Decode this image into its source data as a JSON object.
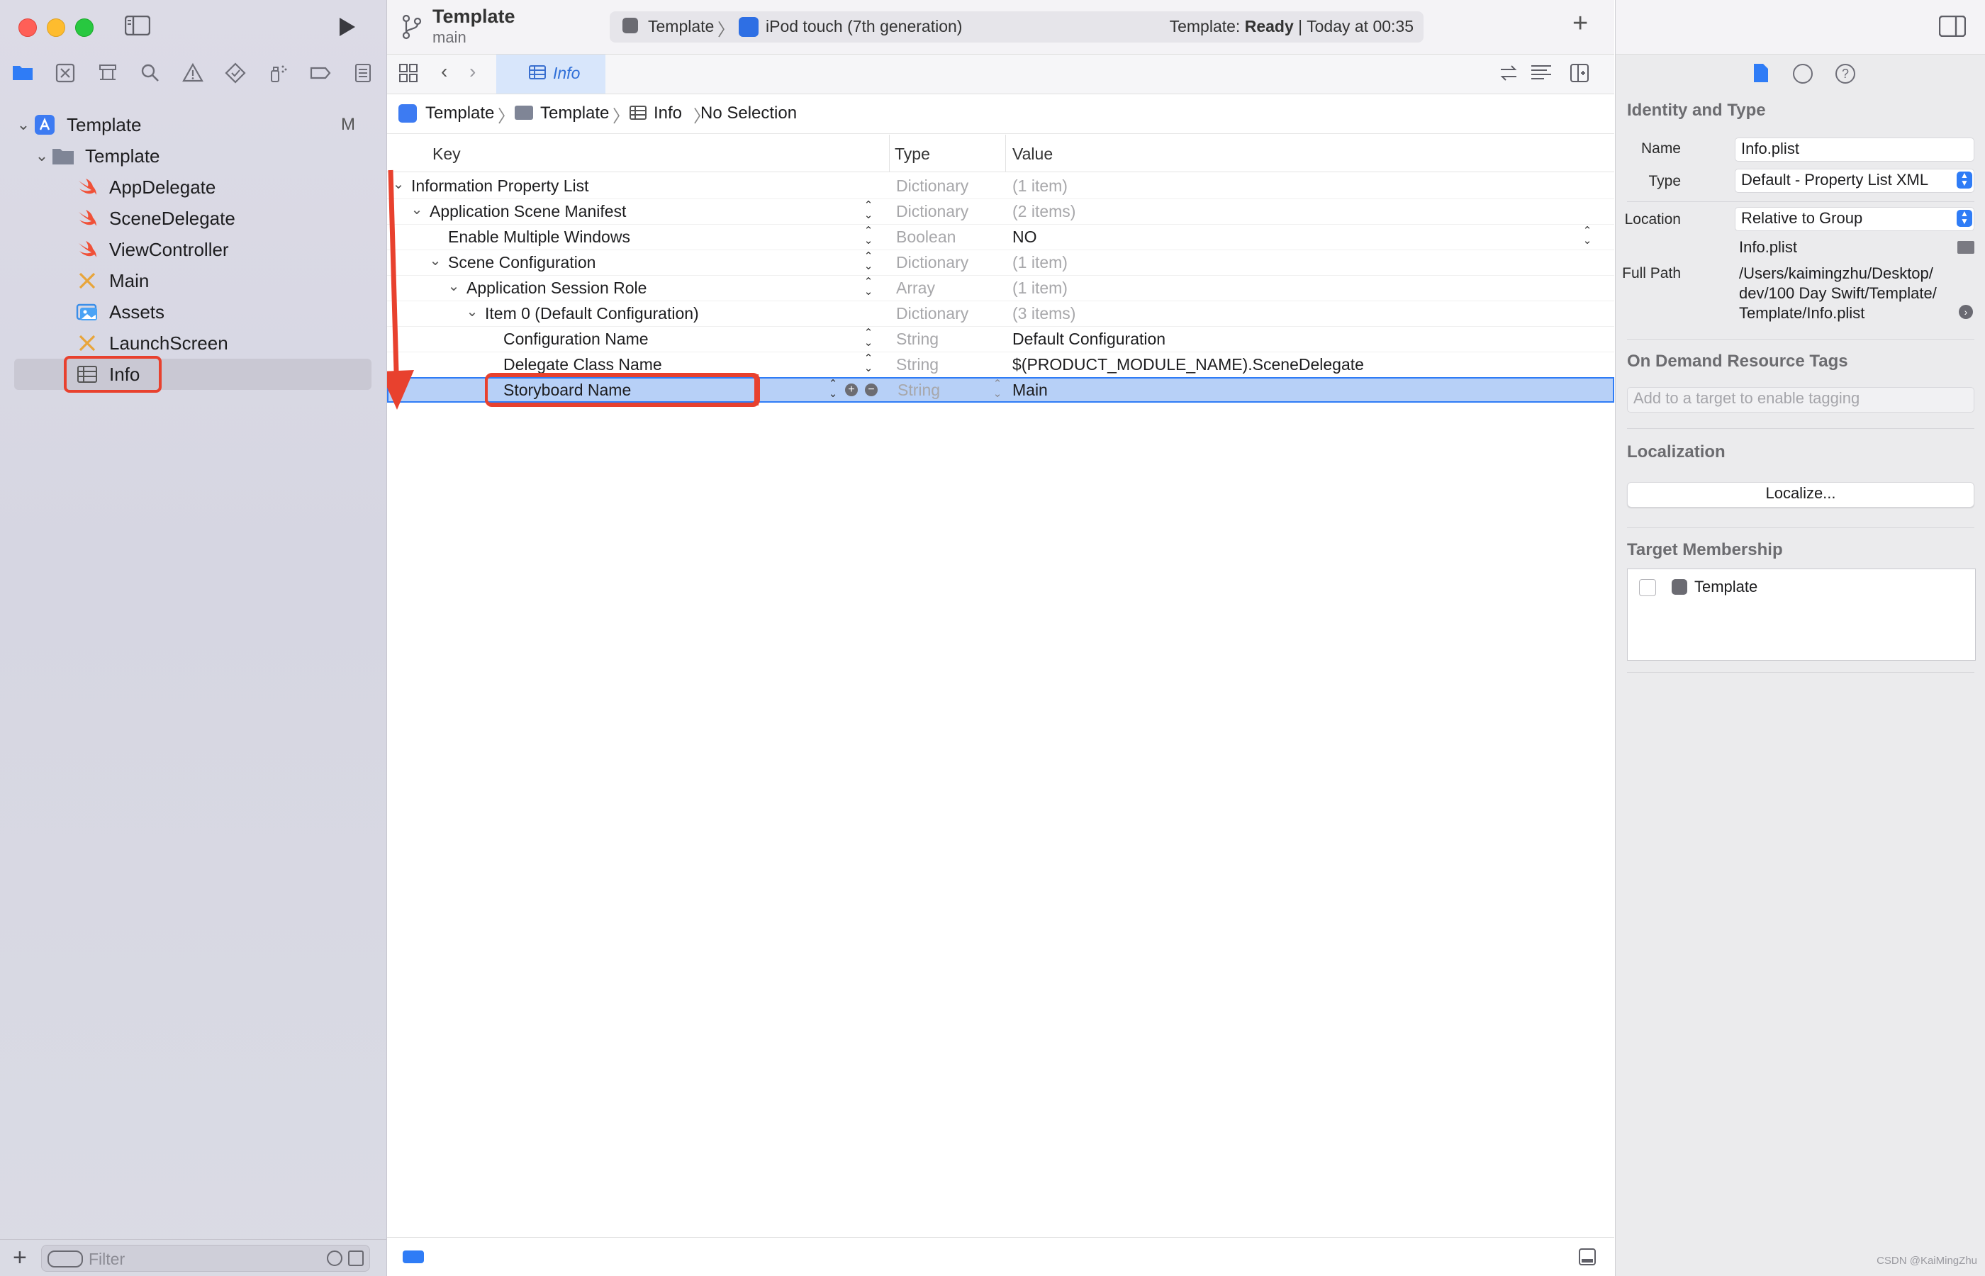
{
  "toolbar": {
    "project_title": "Template",
    "branch": "main",
    "scheme": "Template",
    "destination": "iPod touch (7th generation)",
    "status_prefix": "Template: ",
    "status_state": "Ready",
    "status_suffix": " | Today at 00:35",
    "add_label": "+"
  },
  "sidebar": {
    "project": {
      "label": "Template",
      "badge": "M"
    },
    "group": {
      "label": "Template"
    },
    "items": [
      {
        "label": "AppDelegate",
        "icon": "swift-file-icon"
      },
      {
        "label": "SceneDelegate",
        "icon": "swift-file-icon"
      },
      {
        "label": "ViewController",
        "icon": "swift-file-icon"
      },
      {
        "label": "Main",
        "icon": "storyboard-icon"
      },
      {
        "label": "Assets",
        "icon": "asset-catalog-icon"
      },
      {
        "label": "LaunchScreen",
        "icon": "storyboard-icon"
      },
      {
        "label": "Info",
        "icon": "plist-icon"
      }
    ],
    "filter_placeholder": "Filter"
  },
  "editor": {
    "tab_label": "Info",
    "jumpbar": [
      "Template",
      "Template",
      "Info",
      "No Selection"
    ],
    "columns": {
      "key": "Key",
      "type": "Type",
      "value": "Value"
    },
    "rows": [
      {
        "key": "Information Property List",
        "type": "Dictionary",
        "value": "(1 item)"
      },
      {
        "key": "Application Scene Manifest",
        "type": "Dictionary",
        "value": "(2 items)"
      },
      {
        "key": "Enable Multiple Windows",
        "type": "Boolean",
        "value": "NO"
      },
      {
        "key": "Scene Configuration",
        "type": "Dictionary",
        "value": "(1 item)"
      },
      {
        "key": "Application Session Role",
        "type": "Array",
        "value": "(1 item)"
      },
      {
        "key": "Item 0 (Default Configuration)",
        "type": "Dictionary",
        "value": "(3 items)"
      },
      {
        "key": "Configuration Name",
        "type": "String",
        "value": "Default Configuration"
      },
      {
        "key": "Delegate Class Name",
        "type": "String",
        "value": "$(PRODUCT_MODULE_NAME).SceneDelegate"
      },
      {
        "key": "Storyboard Name",
        "type": "String",
        "value": "Main"
      }
    ]
  },
  "inspector": {
    "identity_title": "Identity and Type",
    "name_label": "Name",
    "name_value": "Info.plist",
    "type_label": "Type",
    "type_value": "Default - Property List XML",
    "location_label": "Location",
    "location_value": "Relative to Group",
    "location_file": "Info.plist",
    "fullpath_label": "Full Path",
    "fullpath_line1": "/Users/kaimingzhu/Desktop/",
    "fullpath_line2": "dev/100 Day Swift/Template/",
    "fullpath_line3": "Template/Info.plist",
    "odr_title": "On Demand Resource Tags",
    "odr_placeholder": "Add to a target to enable tagging",
    "localization_title": "Localization",
    "localize_button": "Localize...",
    "target_title": "Target Membership",
    "target_name": "Template"
  },
  "watermark": "CSDN @KaiMingZhu",
  "colors": {
    "accent": "#2f7cf6",
    "selection": "#b7d0f7",
    "annotation_red": "#e8412e",
    "swift_orange": "#f05138"
  }
}
